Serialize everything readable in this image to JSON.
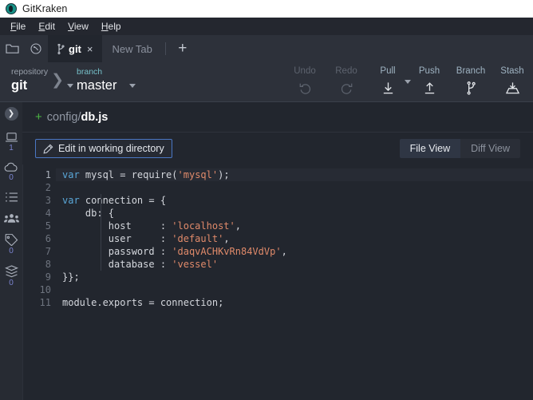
{
  "window": {
    "title": "GitKraken",
    "logo_icon": "gitkraken-logo-icon"
  },
  "menubar": {
    "items": [
      {
        "label": "File",
        "accel": "F"
      },
      {
        "label": "Edit",
        "accel": "E"
      },
      {
        "label": "View",
        "accel": "V"
      },
      {
        "label": "Help",
        "accel": "H"
      }
    ]
  },
  "tabstrip": {
    "folder_icon": "folder-icon",
    "globe_icon": "globe-icon",
    "tabs": [
      {
        "label": "git",
        "icon": "branch-icon",
        "close": "×",
        "active": true
      },
      {
        "label": "New Tab",
        "active": false
      }
    ],
    "add_tab": "+"
  },
  "toolbar": {
    "repository": {
      "label": "repository",
      "value": "git"
    },
    "branch": {
      "label": "branch",
      "value": "master"
    },
    "actions": [
      {
        "label": "Undo",
        "icon": "undo-icon",
        "enabled": false
      },
      {
        "label": "Redo",
        "icon": "redo-icon",
        "enabled": false
      },
      {
        "label": "Pull",
        "icon": "pull-icon",
        "enabled": true,
        "has_dropdown": true
      },
      {
        "label": "Push",
        "icon": "push-icon",
        "enabled": true
      },
      {
        "label": "Branch",
        "icon": "branch-icon",
        "enabled": true
      },
      {
        "label": "Stash",
        "icon": "stash-icon",
        "enabled": true
      }
    ]
  },
  "sidebar": {
    "toggle_icon": "chevron-right-icon",
    "items": [
      {
        "icon": "local-repo-icon",
        "name": "local",
        "count": "1"
      },
      {
        "icon": "remote-cloud-icon",
        "name": "remote",
        "count": "0"
      },
      {
        "icon": "list-icon",
        "name": "pull-requests",
        "count": ""
      },
      {
        "icon": "people-icon",
        "name": "team",
        "count": ""
      },
      {
        "icon": "tag-icon",
        "name": "tags",
        "count": "0"
      },
      {
        "icon": "stash-stack-icon",
        "name": "stashes",
        "count": "0"
      }
    ]
  },
  "file_header": {
    "status_marker": "+",
    "path_prefix": "config/",
    "file_name": "db.js"
  },
  "action_bar": {
    "edit_button": {
      "label": "Edit in working directory",
      "icon": "pencil-icon"
    },
    "view_toggle": {
      "options": [
        {
          "label": "File View",
          "selected": true
        },
        {
          "label": "Diff View",
          "selected": false
        }
      ]
    }
  },
  "editor": {
    "current_line": 1,
    "line_numbers": [
      "1",
      "2",
      "3",
      "4",
      "5",
      "6",
      "7",
      "8",
      "9",
      "10",
      "11"
    ],
    "lines": [
      {
        "n": 1,
        "tokens": [
          {
            "t": "kw",
            "v": "var"
          },
          {
            "t": "plain",
            "v": " mysql = require("
          },
          {
            "t": "str",
            "v": "'mysql'"
          },
          {
            "t": "plain",
            "v": ");"
          }
        ]
      },
      {
        "n": 2,
        "tokens": [
          {
            "t": "plain",
            "v": ""
          }
        ]
      },
      {
        "n": 3,
        "tokens": [
          {
            "t": "kw",
            "v": "var"
          },
          {
            "t": "plain",
            "v": " connection = {"
          }
        ]
      },
      {
        "n": 4,
        "tokens": [
          {
            "t": "plain",
            "v": "    db: {"
          }
        ]
      },
      {
        "n": 5,
        "tokens": [
          {
            "t": "plain",
            "v": "        host     : "
          },
          {
            "t": "str",
            "v": "'localhost'"
          },
          {
            "t": "plain",
            "v": ","
          }
        ]
      },
      {
        "n": 6,
        "tokens": [
          {
            "t": "plain",
            "v": "        user     : "
          },
          {
            "t": "str",
            "v": "'default'"
          },
          {
            "t": "plain",
            "v": ","
          }
        ]
      },
      {
        "n": 7,
        "tokens": [
          {
            "t": "plain",
            "v": "        password : "
          },
          {
            "t": "str",
            "v": "'daqvACHKvRn84VdVp'"
          },
          {
            "t": "plain",
            "v": ","
          }
        ]
      },
      {
        "n": 8,
        "tokens": [
          {
            "t": "plain",
            "v": "        database : "
          },
          {
            "t": "str",
            "v": "'vessel'"
          }
        ]
      },
      {
        "n": 9,
        "tokens": [
          {
            "t": "plain",
            "v": "}};"
          }
        ]
      },
      {
        "n": 10,
        "tokens": [
          {
            "t": "plain",
            "v": ""
          }
        ]
      },
      {
        "n": 11,
        "tokens": [
          {
            "t": "plain",
            "v": "module.exports = connection;"
          }
        ]
      }
    ]
  },
  "colors": {
    "app_bg": "#22262e",
    "chrome_bg": "#2d313a",
    "sidebar_bg": "#272b33",
    "accent_blue": "#4a77c4",
    "teal_label": "#76c0c9",
    "added_green": "#4bb543",
    "string_orange": "#e08a6a",
    "keyword_blue": "#5aa7d8",
    "count_purple": "#7b84d0"
  }
}
